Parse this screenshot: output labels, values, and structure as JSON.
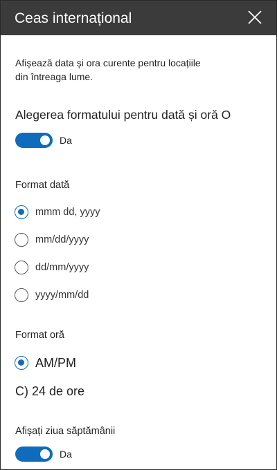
{
  "header": {
    "title": "Ceas internațional"
  },
  "description": {
    "line1": "Afișează data și ora curente pentru locațiile",
    "line2": "din întreaga lume."
  },
  "format_section": {
    "heading": "Alegerea formatului pentru dată și oră O",
    "toggle": {
      "on": true,
      "label": "Da"
    }
  },
  "date_format": {
    "label": "Format dată",
    "options": [
      {
        "label": "mmm dd, yyyy",
        "checked": true
      },
      {
        "label": "mm/dd/yyyy",
        "checked": false
      },
      {
        "label": "dd/mm/yyyy",
        "checked": false
      },
      {
        "label": "yyyy/mm/dd",
        "checked": false
      }
    ]
  },
  "time_format": {
    "label": "Format oră",
    "option_ampm": {
      "label": "AM/PM",
      "checked": true
    },
    "option_24h_text": "C) 24 de ore"
  },
  "weekday": {
    "label": "Afișați ziua săptămânii",
    "toggle": {
      "on": true,
      "label": "Da"
    }
  },
  "colors": {
    "header_bg": "#3b3b3b",
    "accent": "#0f6cbd"
  }
}
